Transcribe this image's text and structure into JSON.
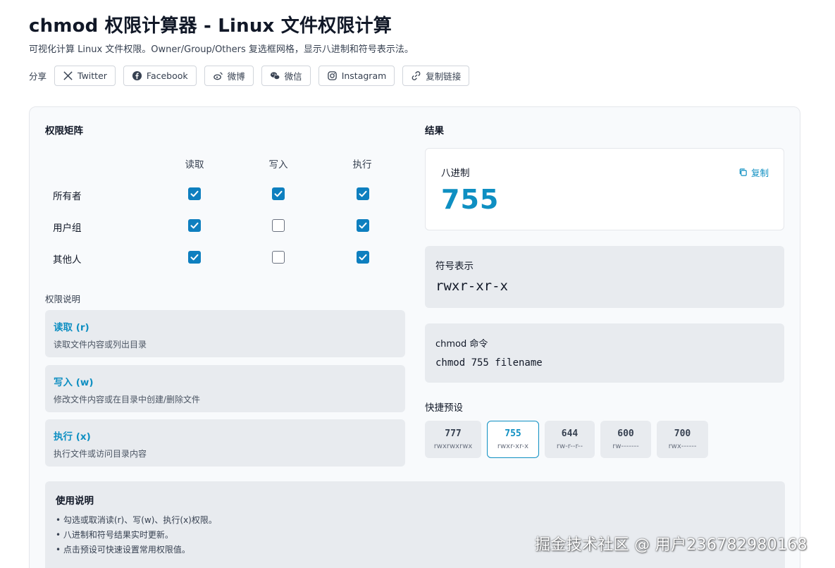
{
  "header": {
    "title": "chmod 权限计算器 - Linux 文件权限计算",
    "subtitle": "可视化计算 Linux 文件权限。Owner/Group/Others 复选框网格，显示八进制和符号表示法。"
  },
  "share": {
    "label": "分享",
    "buttons": [
      {
        "label": "Twitter",
        "icon": "x-icon"
      },
      {
        "label": "Facebook",
        "icon": "facebook-icon"
      },
      {
        "label": "微博",
        "icon": "weibo-icon"
      },
      {
        "label": "微信",
        "icon": "wechat-icon"
      },
      {
        "label": "Instagram",
        "icon": "instagram-icon"
      },
      {
        "label": "复制链接",
        "icon": "link-icon"
      }
    ]
  },
  "matrix": {
    "title": "权限矩阵",
    "columns": [
      "读取",
      "写入",
      "执行"
    ],
    "rows": [
      {
        "label": "所有者",
        "values": [
          true,
          true,
          true
        ]
      },
      {
        "label": "用户组",
        "values": [
          true,
          false,
          true
        ]
      },
      {
        "label": "其他人",
        "values": [
          true,
          false,
          true
        ]
      }
    ]
  },
  "perm_desc": {
    "title": "权限说明",
    "items": [
      {
        "title": "读取 (r)",
        "desc": "读取文件内容或列出目录"
      },
      {
        "title": "写入 (w)",
        "desc": "修改文件内容或在目录中创建/删除文件"
      },
      {
        "title": "执行 (x)",
        "desc": "执行文件或访问目录内容"
      }
    ]
  },
  "result": {
    "title": "结果",
    "octal_label": "八进制",
    "copy_label": "复制",
    "octal_value": "755",
    "symbolic_label": "符号表示",
    "symbolic_value": "rwxr-xr-x",
    "command_label": "chmod 命令",
    "command_value": "chmod 755 filename"
  },
  "presets": {
    "title": "快捷预设",
    "items": [
      {
        "value": "777",
        "symbolic": "rwxrwxrwx",
        "active": false
      },
      {
        "value": "755",
        "symbolic": "rwxr-xr-x",
        "active": true
      },
      {
        "value": "644",
        "symbolic": "rw-r--r--",
        "active": false
      },
      {
        "value": "600",
        "symbolic": "rw-------",
        "active": false
      },
      {
        "value": "700",
        "symbolic": "rwx------",
        "active": false
      }
    ]
  },
  "usage": {
    "title": "使用说明",
    "items": [
      "勾选或取消读(r)、写(w)、执行(x)权限。",
      "八进制和符号结果实时更新。",
      "点击预设可快速设置常用权限值。"
    ]
  },
  "watermark": "掘金技术社区 @ 用户2367829801­68",
  "colors": {
    "accent": "#0e8fc2",
    "checkbox": "#0e7fbf",
    "panel": "#e8ebef"
  }
}
